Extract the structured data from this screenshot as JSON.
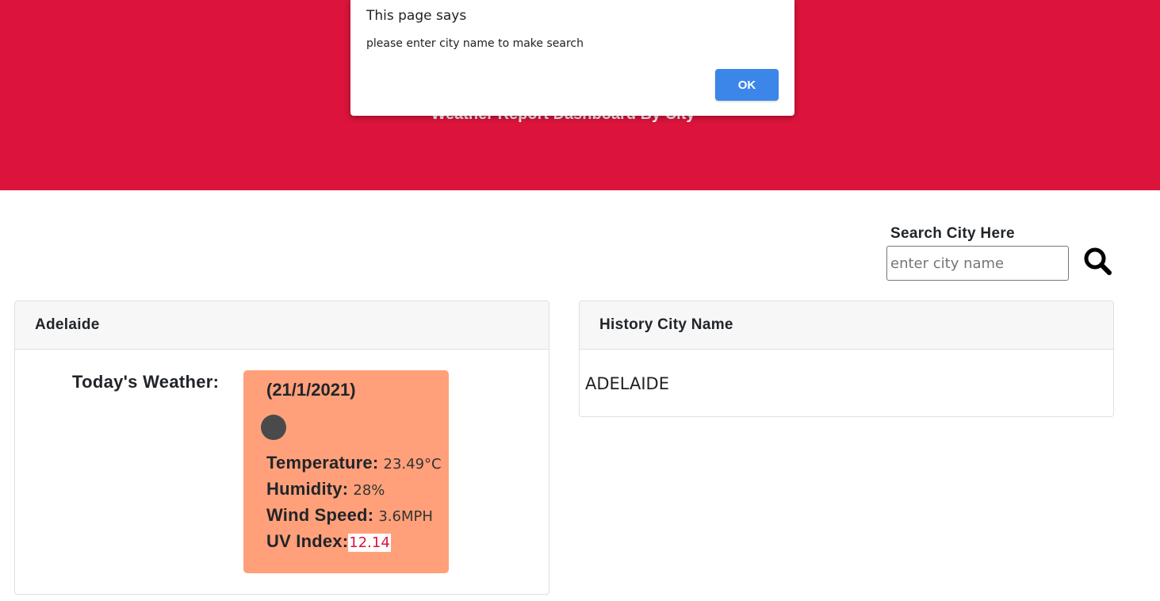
{
  "header": {
    "title": "Weather Report Dashboard By City"
  },
  "search": {
    "label": "Search City Here",
    "placeholder": "enter city name",
    "value": "",
    "button_icon": "search-icon"
  },
  "weather_card": {
    "city": "Adelaide",
    "todays_label": "Today's Weather:",
    "date": "(21/1/2021)",
    "icon": "weather-icon",
    "temperature_label": "Temperature:",
    "temperature_value": "23.49°C",
    "humidity_label": "Humidity:",
    "humidity_value": "28%",
    "wind_label": "Wind Speed:",
    "wind_value": "3.6MPH",
    "uv_label": "UV Index:",
    "uv_value": "12.14"
  },
  "history_card": {
    "title": "History City Name",
    "items": [
      "ADELAIDE"
    ]
  },
  "alert_dialog": {
    "title": "This page says",
    "message": "please enter city name to make search",
    "ok_label": "OK"
  },
  "colors": {
    "banner": "#dc143c",
    "forecast_box": "#ffa07a",
    "uv_text": "#dc143c",
    "ok_button": "#3b86e8"
  }
}
